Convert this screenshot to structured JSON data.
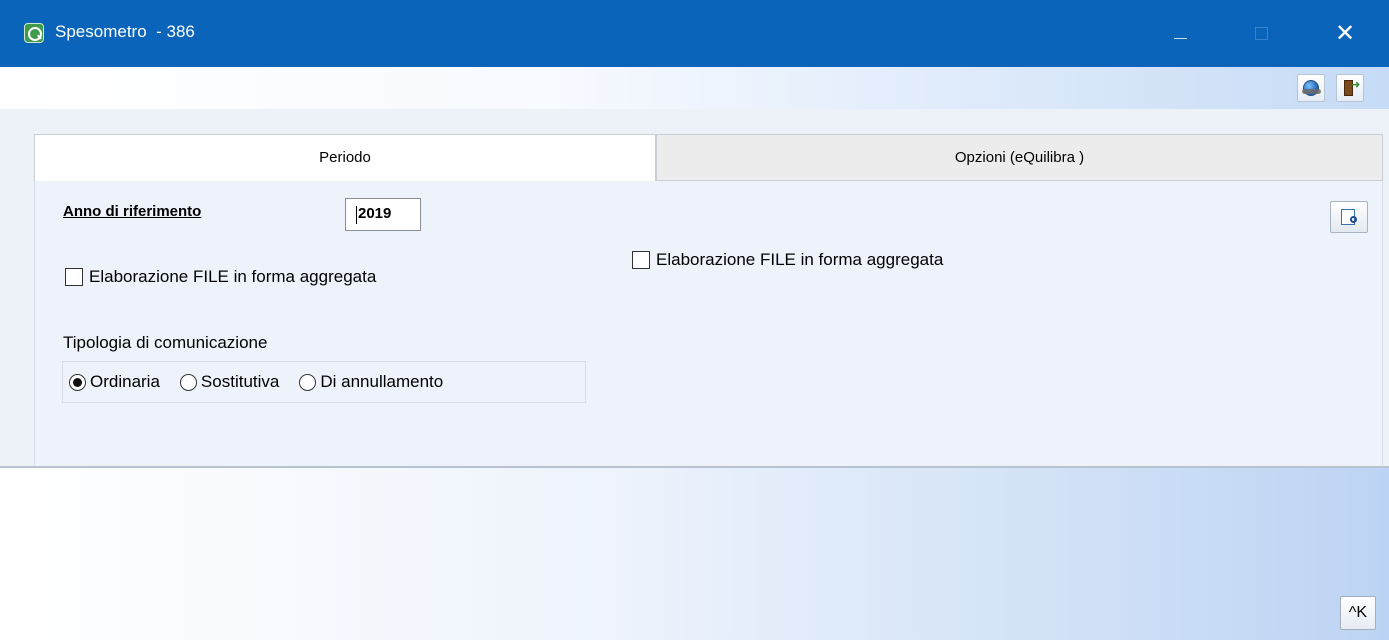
{
  "window": {
    "title": "Spesometro  - 386",
    "app_icon": "app-logo-icon",
    "controls": {
      "minimize": "—",
      "maximize": "☐",
      "close": "✕"
    },
    "accent_color": "#0a64ba"
  },
  "toolbar": {
    "icons": [
      "globe-link-icon",
      "exit-door-icon"
    ]
  },
  "tabs": [
    {
      "label": "Periodo",
      "active": true
    },
    {
      "label": "Opzioni (eQuilibra )",
      "active": false
    }
  ],
  "periodo": {
    "anno_label": "Anno di riferimento",
    "anno_value": "2019",
    "aggregata_left_label": "Elaborazione FILE in forma aggregata",
    "aggregata_left_checked": false,
    "aggregata_right_label": "Elaborazione FILE in forma aggregata",
    "aggregata_right_checked": false,
    "tipologia_label": "Tipologia di comunicazione",
    "tipologia_options": [
      {
        "label": "Ordinaria",
        "selected": true
      },
      {
        "label": "Sostitutiva",
        "selected": false
      },
      {
        "label": "Di annullamento",
        "selected": false
      }
    ],
    "lookup_icon": "document-search-icon"
  },
  "footer": {
    "button_label": "^K"
  }
}
